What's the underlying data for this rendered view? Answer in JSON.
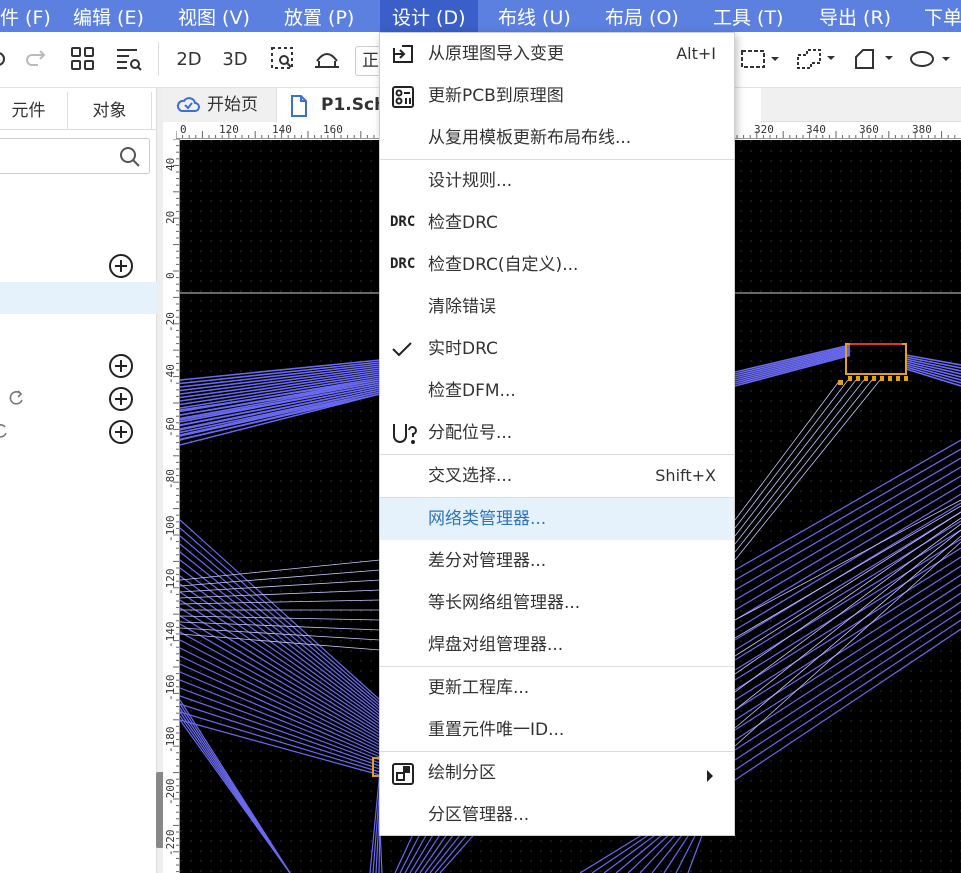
{
  "menubar": {
    "items": [
      {
        "label": "件 (F)"
      },
      {
        "label": "编辑 (E)"
      },
      {
        "label": "视图 (V)"
      },
      {
        "label": "放置 (P)"
      },
      {
        "label": "设计 (D)"
      },
      {
        "label": "布线 (U)"
      },
      {
        "label": "布局 (O)"
      },
      {
        "label": "工具 (T)"
      },
      {
        "label": "导出 (R)"
      },
      {
        "label": "下单"
      }
    ],
    "active_color": "#3a5fc8",
    "bar_color": "#5b80e0"
  },
  "toolbar": {
    "btn_2d": "2D",
    "btn_3d": "3D",
    "input_value": "正"
  },
  "left_panel": {
    "tabs": [
      {
        "label": "元件"
      },
      {
        "label": "对象"
      }
    ]
  },
  "doc_tabs": {
    "items": [
      {
        "label": "开始页"
      },
      {
        "label": "P1.Sch"
      }
    ]
  },
  "rulers": {
    "h_ticks": [
      "0",
      "120",
      "140",
      "160",
      "320",
      "340",
      "360",
      "380"
    ],
    "v_ticks": [
      "40",
      "20",
      "0",
      "-20",
      "-40",
      "-60",
      "-80",
      "-100",
      "-120",
      "-140",
      "-160",
      "-180",
      "-200",
      "-220"
    ]
  },
  "design_menu": {
    "items": [
      {
        "label": "从原理图导入变更",
        "shortcut": "Alt+I",
        "icon": "import-icon"
      },
      {
        "label": "更新PCB到原理图",
        "shortcut": "",
        "icon": "update-sch-icon"
      },
      {
        "label": "从复用模板更新布局布线...",
        "shortcut": "",
        "icon": ""
      },
      {
        "label": "设计规则...",
        "shortcut": "",
        "icon": ""
      },
      {
        "label": "检查DRC",
        "shortcut": "",
        "icon": "drc-icon"
      },
      {
        "label": "检查DRC(自定义)...",
        "shortcut": "",
        "icon": "drc-icon"
      },
      {
        "label": "清除错误",
        "shortcut": "",
        "icon": ""
      },
      {
        "label": "实时DRC",
        "shortcut": "",
        "icon": "check-icon"
      },
      {
        "label": "检查DFM...",
        "shortcut": "",
        "icon": ""
      },
      {
        "label": "分配位号...",
        "shortcut": "",
        "icon": "designator-icon"
      },
      {
        "label": "交叉选择...",
        "shortcut": "Shift+X",
        "icon": ""
      },
      {
        "label": "网络类管理器...",
        "shortcut": "",
        "icon": "",
        "highlighted": true
      },
      {
        "label": "差分对管理器...",
        "shortcut": "",
        "icon": ""
      },
      {
        "label": "等长网络组管理器...",
        "shortcut": "",
        "icon": ""
      },
      {
        "label": "焊盘对组管理器...",
        "shortcut": "",
        "icon": ""
      },
      {
        "label": "更新工程库...",
        "shortcut": "",
        "icon": ""
      },
      {
        "label": "重置元件唯一ID...",
        "shortcut": "",
        "icon": ""
      },
      {
        "label": "绘制分区",
        "shortcut": "",
        "icon": "region-icon",
        "submenu": true
      },
      {
        "label": "分区管理器...",
        "shortcut": "",
        "icon": ""
      }
    ],
    "drc_icon_text": "DRC",
    "highlight_color": "#e6f2fb",
    "highlight_text_color": "#2f74c0"
  },
  "canvas": {
    "background": "#000000",
    "ratline_color": "#6a6af0",
    "component_color": "#e0a020"
  }
}
